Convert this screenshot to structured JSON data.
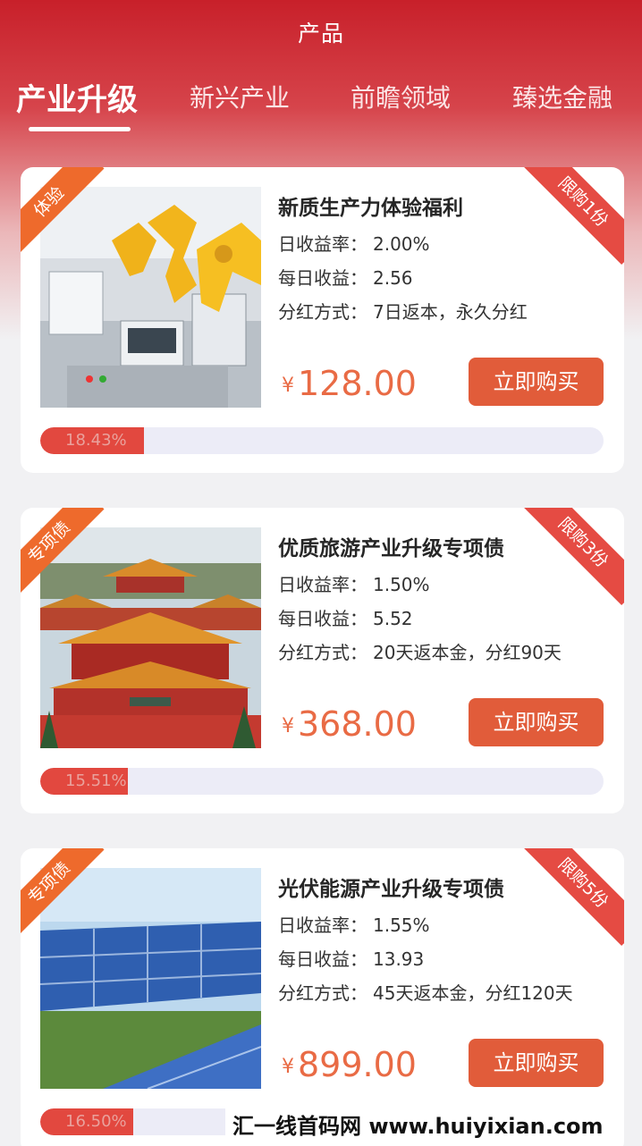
{
  "header": {
    "title": "产品"
  },
  "tabs": [
    {
      "label": "产业升级",
      "active": true
    },
    {
      "label": "新兴产业",
      "active": false
    },
    {
      "label": "前瞻领域",
      "active": false
    },
    {
      "label": "臻选金融",
      "active": false
    }
  ],
  "labels": {
    "daily_rate": "日收益率：",
    "daily_income": "每日收益：",
    "dividend": "分红方式：",
    "currency": "¥",
    "buy": "立即购买"
  },
  "products": [
    {
      "tag": "体验",
      "limit": "限购1份",
      "name": "新质生产力体验福利",
      "daily_rate": "2.00%",
      "daily_income": "2.56",
      "dividend": "7日返本，永久分红",
      "price": "128.00",
      "progress": 18.43,
      "progress_label": "18.43%",
      "image_icon": "industrial-robot-image"
    },
    {
      "tag": "专项债",
      "limit": "限购3份",
      "name": "优质旅游产业升级专项债",
      "daily_rate": "1.50%",
      "daily_income": "5.52",
      "dividend": "20天返本金，分红90天",
      "price": "368.00",
      "progress": 15.51,
      "progress_label": "15.51%",
      "image_icon": "forbidden-city-image"
    },
    {
      "tag": "专项债",
      "limit": "限购5份",
      "name": "光伏能源产业升级专项债",
      "daily_rate": "1.55%",
      "daily_income": "13.93",
      "dividend": "45天返本金，分红120天",
      "price": "899.00",
      "progress": 16.5,
      "progress_label": "16.50%",
      "image_icon": "solar-panel-image"
    }
  ],
  "watermark": "汇一线首码网 www.huiyixian.com",
  "colors": {
    "brand_red": "#c8202a",
    "price": "#e96b45",
    "button": "#e15c3a",
    "progress_fill": "#e2483f",
    "tag": "#ee6a2c"
  }
}
